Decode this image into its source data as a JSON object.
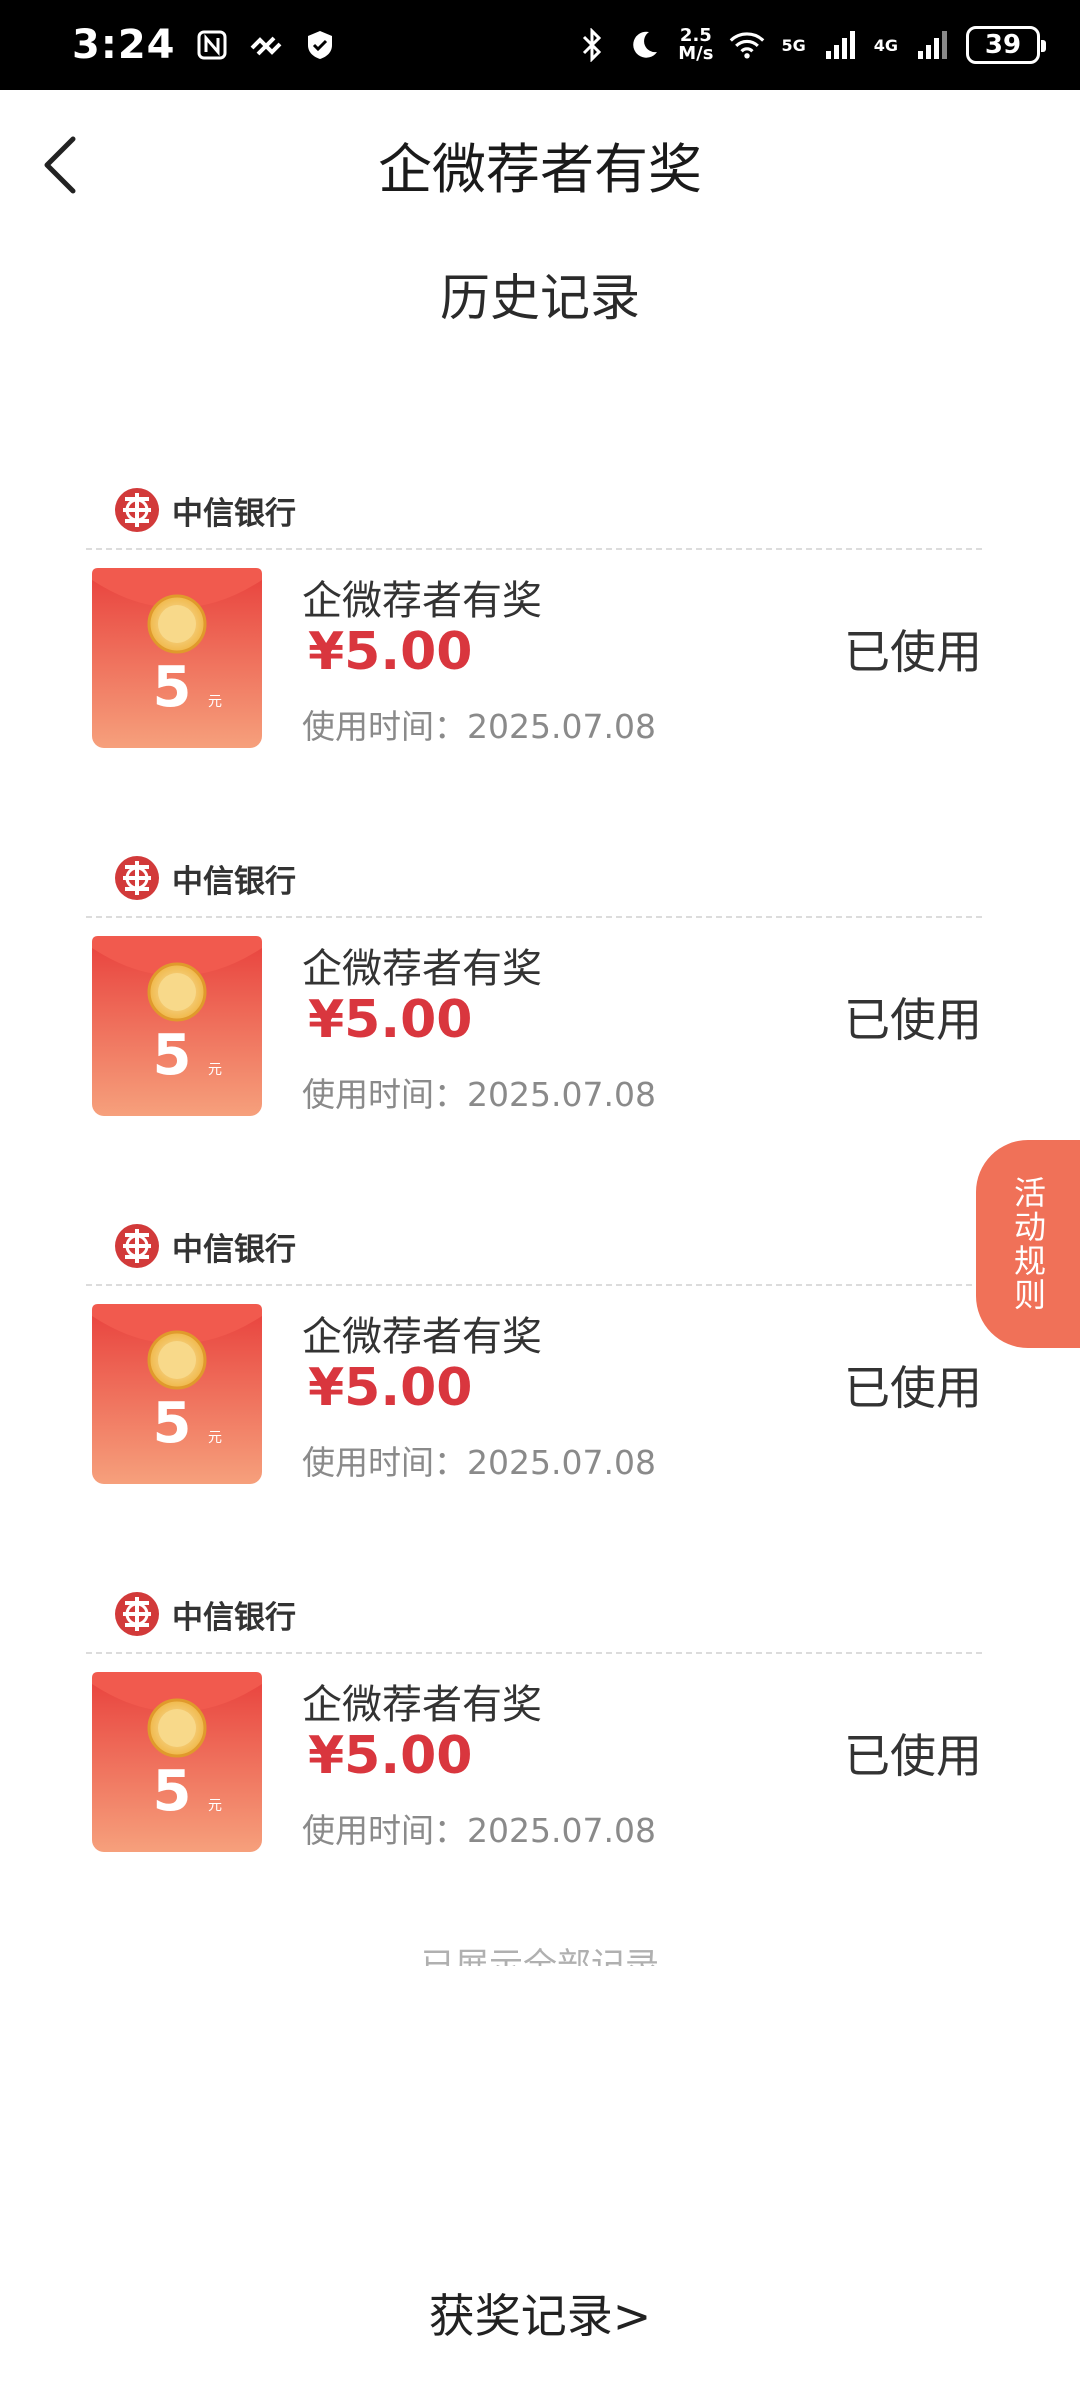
{
  "status_bar": {
    "time": "3:24",
    "speed_top": "2.5",
    "speed_bottom": "M/s",
    "net_5g": "5G",
    "net_4g": "4G",
    "battery": "39"
  },
  "header": {
    "title": "企微荐者有奖"
  },
  "section": {
    "title": "历史记录"
  },
  "records": [
    {
      "bank": "中信银行",
      "title": "企微荐者有奖",
      "amount": "¥5.00",
      "time": "使用时间：2025.07.08",
      "status": "已使用",
      "badge_value": "5",
      "badge_unit": "元"
    },
    {
      "bank": "中信银行",
      "title": "企微荐者有奖",
      "amount": "¥5.00",
      "time": "使用时间：2025.07.08",
      "status": "已使用",
      "badge_value": "5",
      "badge_unit": "元"
    },
    {
      "bank": "中信银行",
      "title": "企微荐者有奖",
      "amount": "¥5.00",
      "time": "使用时间：2025.07.08",
      "status": "已使用",
      "badge_value": "5",
      "badge_unit": "元"
    },
    {
      "bank": "中信银行",
      "title": "企微荐者有奖",
      "amount": "¥5.00",
      "time": "使用时间：2025.07.08",
      "status": "已使用",
      "badge_value": "5",
      "badge_unit": "元"
    }
  ],
  "footer": {
    "end_text": "已展示全部记录",
    "award_link": "获奖记录>"
  },
  "side_tab": {
    "label": "活动规则"
  },
  "colors": {
    "accent_red": "#d9363e",
    "rules_tab": "#f07158"
  }
}
